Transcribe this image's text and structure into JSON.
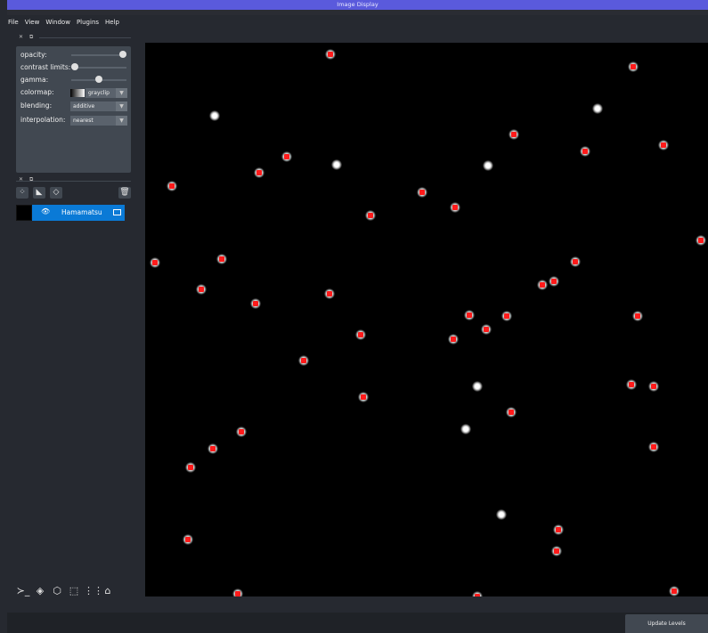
{
  "window": {
    "title": "Image Display"
  },
  "menu": [
    "File",
    "View",
    "Window",
    "Plugins",
    "Help"
  ],
  "controls": {
    "opacity_label": "opacity:",
    "opacity_value": 1.0,
    "contrast_label": "contrast limits:",
    "contrast_value": 0.0,
    "gamma_label": "gamma:",
    "gamma_value": 0.5,
    "colormap_label": "colormap:",
    "colormap_value": "grayclip",
    "blending_label": "blending:",
    "blending_value": "additive",
    "interpolation_label": "interpolation:",
    "interpolation_value": "nearest"
  },
  "layers": [
    {
      "name": "Hamamatsu",
      "visible": true,
      "selected": true
    }
  ],
  "footer": {
    "update_button": "Update Levels"
  },
  "icons": {
    "points": "points-icon",
    "shapes": "shapes-icon",
    "labels": "labels-icon",
    "delete": "trash-icon",
    "console": "console-icon",
    "ndisplay": "ndisplay-icon",
    "roll": "roll-icon",
    "transpose": "transpose-icon",
    "grid": "grid-icon",
    "home": "home-icon",
    "eye": "eye-icon",
    "image": "image-layer-icon"
  },
  "colors": {
    "selected_layer": "#0a7ad6",
    "title_bar": "#5a5adc",
    "spot_center": "#ff1a1a"
  }
}
